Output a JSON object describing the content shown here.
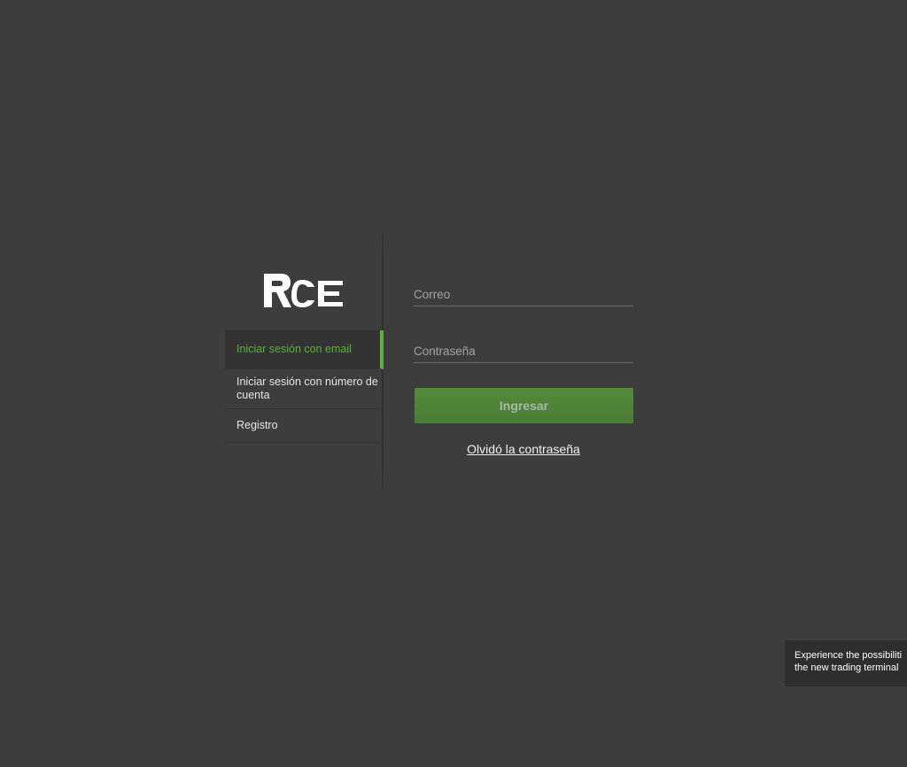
{
  "brand": {
    "logo_text": "RCE",
    "accent_color": "#5cb33a",
    "button_color": "#4f8539"
  },
  "nav": {
    "items": [
      {
        "label": "Iniciar sesión con email",
        "active": true
      },
      {
        "label": "Iniciar sesión con número de cuenta",
        "active": false
      },
      {
        "label": "Registro",
        "active": false
      }
    ]
  },
  "form": {
    "email_placeholder": "Correo",
    "email_value": "",
    "password_placeholder": "Contraseña",
    "password_value": "",
    "submit_label": "Ingresar",
    "forgot_label": "Olvidó la contraseña"
  },
  "promo": {
    "line1": "Experience the possibiliti",
    "line2": "the new trading terminal"
  }
}
